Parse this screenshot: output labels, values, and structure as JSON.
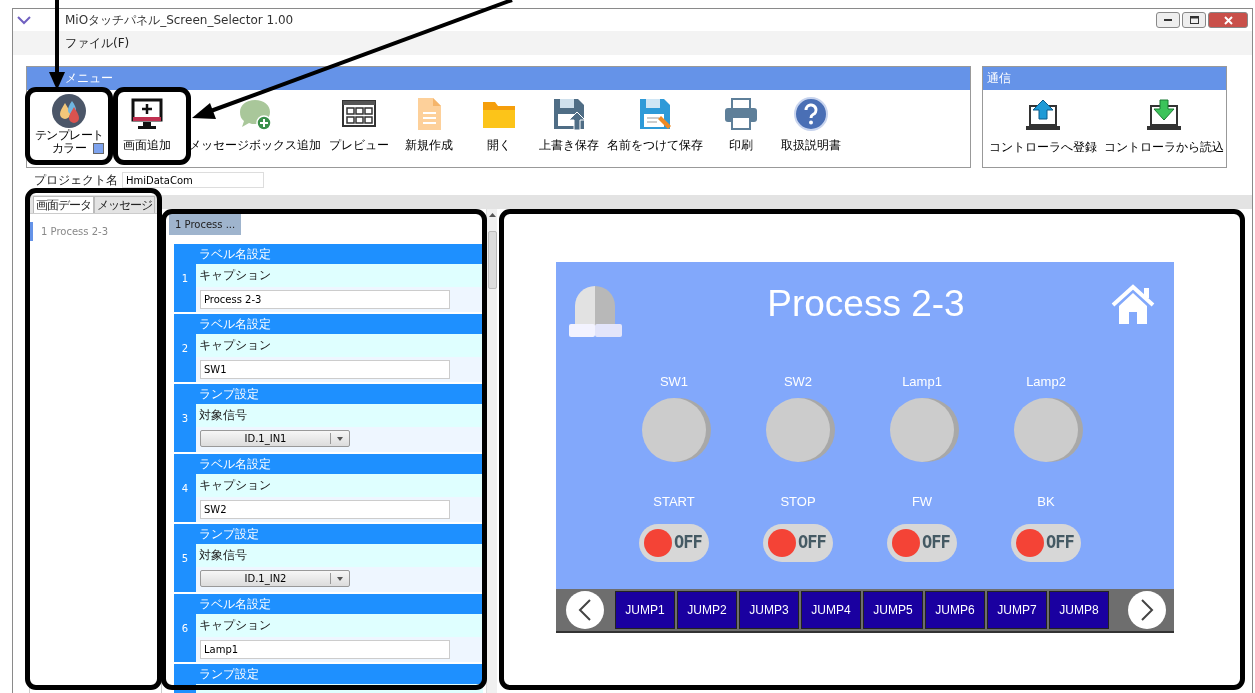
{
  "window": {
    "title": "MiOタッチパネル_Screen_Selector 1.00"
  },
  "menu_bar": [
    "ファイル(F)"
  ],
  "toolbar": {
    "title": "メニュー",
    "items": [
      {
        "label": "テンプレートカラー"
      },
      {
        "label": "画面追加"
      },
      {
        "label": "メッセージボックス追加"
      },
      {
        "label": "プレビュー"
      },
      {
        "label": "新規作成"
      },
      {
        "label": "開く"
      },
      {
        "label": "上書き保存"
      },
      {
        "label": "名前をつけて保存"
      },
      {
        "label": "印刷"
      },
      {
        "label": "取扱説明書"
      }
    ]
  },
  "communication": {
    "title": "通信",
    "items": [
      {
        "label": "コントローラへ登録"
      },
      {
        "label": "コントローラから読込"
      }
    ]
  },
  "project": {
    "label": "プロジェクト名",
    "value": "HmiDataCom"
  },
  "left_panel": {
    "tabs": [
      {
        "label": "画面データ",
        "selected": true
      },
      {
        "label": "メッセージ",
        "selected": false
      }
    ],
    "items": [
      {
        "label": "1 Process 2-3",
        "selected": true
      }
    ]
  },
  "editor": {
    "tab": "1 Process ...",
    "groups": [
      {
        "number": "1",
        "header": "ラベル名設定",
        "label": "キャプション",
        "kind": "text",
        "value": "Process 2-3"
      },
      {
        "number": "2",
        "header": "ラベル名設定",
        "label": "キャプション",
        "kind": "text",
        "value": "SW1"
      },
      {
        "number": "3",
        "header": "ランプ設定",
        "label": "対象信号",
        "kind": "select",
        "value": "ID.1_IN1"
      },
      {
        "number": "4",
        "header": "ラベル名設定",
        "label": "キャプション",
        "kind": "text",
        "value": "SW2"
      },
      {
        "number": "5",
        "header": "ランプ設定",
        "label": "対象信号",
        "kind": "select",
        "value": "ID.1_IN2"
      },
      {
        "number": "6",
        "header": "ラベル名設定",
        "label": "キャプション",
        "kind": "text",
        "value": "Lamp1"
      },
      {
        "header": "ランプ設定",
        "kind": "partial"
      }
    ]
  },
  "preview": {
    "title": "Process 2-3",
    "lamps": [
      {
        "label": "SW1",
        "on": false
      },
      {
        "label": "SW2",
        "on": false
      },
      {
        "label": "Lamp1",
        "on": false
      },
      {
        "label": "Lamp2",
        "on": false
      }
    ],
    "switches": [
      {
        "label": "START",
        "state": "OFF",
        "on": false
      },
      {
        "label": "STOP",
        "state": "OFF",
        "on": false
      },
      {
        "label": "FW",
        "state": "OFF",
        "on": false
      },
      {
        "label": "BK",
        "state": "OFF",
        "on": false
      }
    ],
    "jump_buttons": [
      "JUMP1",
      "JUMP2",
      "JUMP3",
      "JUMP4",
      "JUMP5",
      "JUMP6",
      "JUMP7",
      "JUMP8"
    ]
  }
}
